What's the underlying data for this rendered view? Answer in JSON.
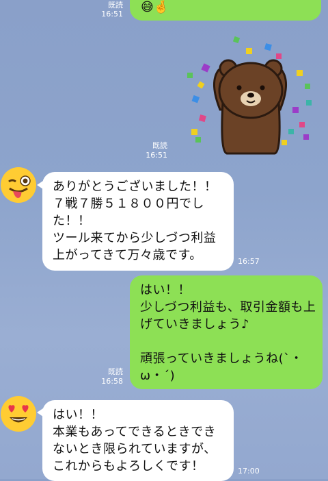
{
  "messages": [
    {
      "id": "m1",
      "side": "outgoing",
      "content": "😅🤞",
      "read_label": "既読",
      "time": "16:51"
    },
    {
      "id": "m2",
      "side": "outgoing",
      "content_type": "sticker",
      "sticker_name": "brown-bear-celebrating-sticker",
      "read_label": "既読",
      "time": "16:51"
    },
    {
      "id": "m3",
      "side": "incoming",
      "avatar_icon": "winking-tongue-emoji-avatar",
      "content": "ありがとうございました！！\n７戦７勝５１８００円でした！！\nツール来てから少しづつ利益上がってきて万々歳です。",
      "time": "16:57"
    },
    {
      "id": "m4",
      "side": "outgoing",
      "content": "はい！！\n少しづつ利益も、取引金額も上げていきましょう♪\n\n頑張っていきましょうね(`・ω・´)",
      "read_label": "既読",
      "time": "16:58"
    },
    {
      "id": "m5",
      "side": "incoming",
      "avatar_icon": "heart-eyes-emoji-avatar",
      "content": "はい！！\n本業もあってできるときできないとき限られていますが、これからもよろしくです！",
      "time": "17:00"
    }
  ],
  "colors": {
    "background": "#8da4cc",
    "outgoing_bubble": "#8de055",
    "incoming_bubble": "#ffffff"
  }
}
